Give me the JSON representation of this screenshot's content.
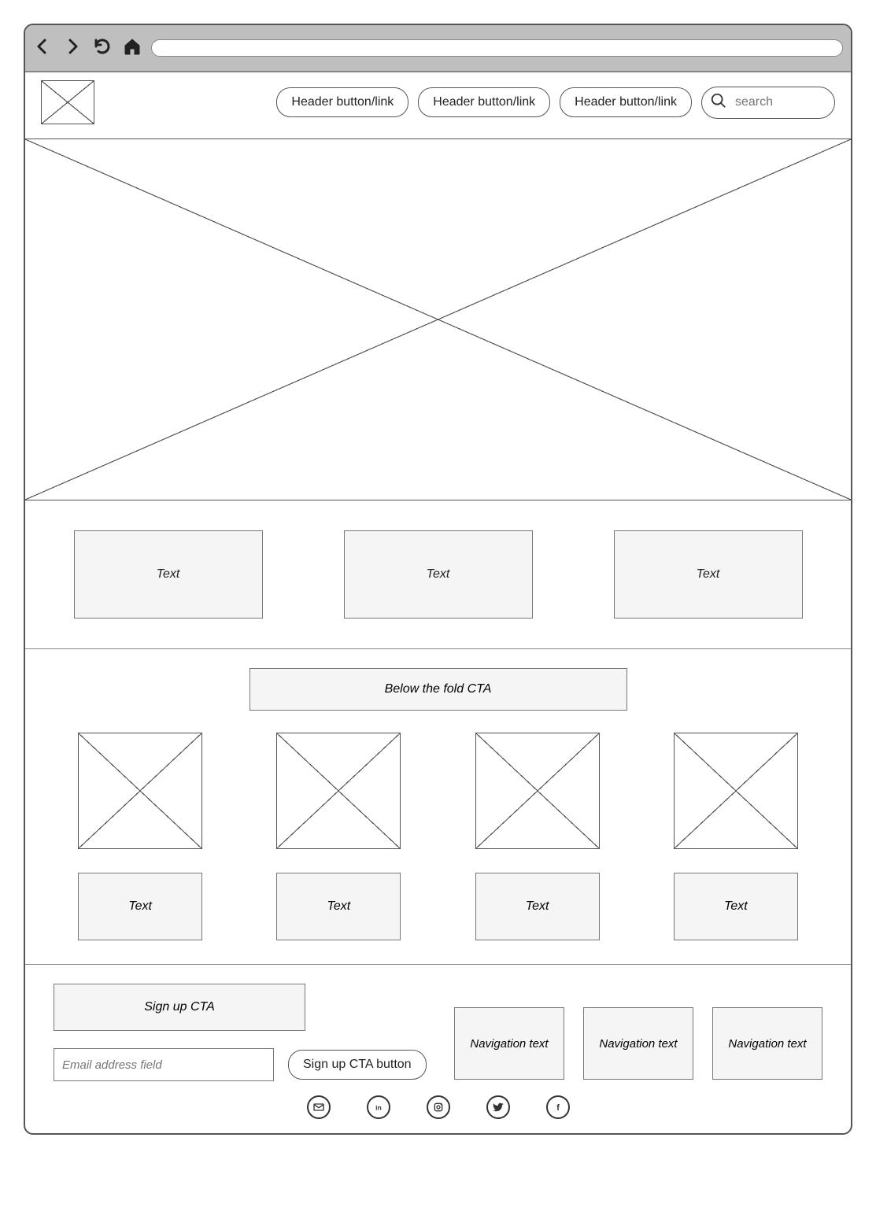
{
  "header": {
    "nav_buttons": [
      "Header button/link",
      "Header button/link",
      "Header button/link"
    ],
    "search_placeholder": "search"
  },
  "row3_texts": [
    "Text",
    "Text",
    "Text"
  ],
  "below_fold_cta": "Below the fold CTA",
  "grid4_texts": [
    "Text",
    "Text",
    "Text",
    "Text"
  ],
  "footer": {
    "signup_cta": "Sign up CTA",
    "email_placeholder": "Email address field",
    "signup_button": "Sign up CTA button",
    "nav_texts": [
      "Navigation text",
      "Navigation text",
      "Navigation text"
    ],
    "social": [
      "mail",
      "linkedin",
      "instagram",
      "twitter",
      "facebook"
    ]
  }
}
